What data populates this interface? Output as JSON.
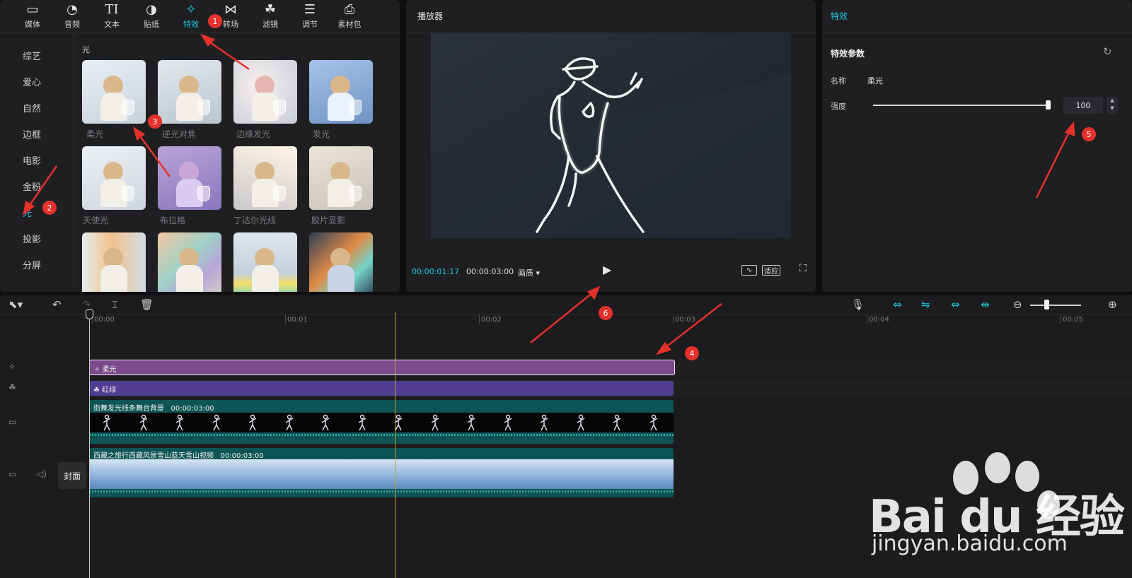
{
  "library": {
    "tabs": [
      {
        "label": "媒体",
        "icon": "media-icon"
      },
      {
        "label": "音频",
        "icon": "audio-icon"
      },
      {
        "label": "文本",
        "icon": "text-icon"
      },
      {
        "label": "贴纸",
        "icon": "sticker-icon"
      },
      {
        "label": "特效",
        "icon": "effects-icon",
        "active": true
      },
      {
        "label": "转场",
        "icon": "transition-icon"
      },
      {
        "label": "滤镜",
        "icon": "filter-icon"
      },
      {
        "label": "调节",
        "icon": "adjust-icon"
      },
      {
        "label": "素材包",
        "icon": "package-icon"
      }
    ],
    "categories": [
      "综艺",
      "爱心",
      "自然",
      "边框",
      "电影",
      "金粉",
      "光",
      "投影",
      "分屏"
    ],
    "active_category": "光",
    "section_title": "光",
    "effects": [
      "柔光",
      "逆光对焦",
      "边缘发光",
      "发光",
      "天使光",
      "布拉格",
      "丁达尔光线",
      "胶片显影",
      "",
      "",
      "",
      ""
    ]
  },
  "player": {
    "title": "播放器",
    "current_time": "00:00:01:17",
    "total_time": "00:00:03:00",
    "quality": "画质",
    "fit_label": "适应"
  },
  "properties": {
    "title": "特效",
    "section": "特效参数",
    "name_label": "名称",
    "name_value": "柔光",
    "strength_label": "强度",
    "strength_value": "100",
    "strength_fraction": 1.0
  },
  "timeline": {
    "ruler": [
      "00:00",
      "00:01",
      "00:02",
      "00:03",
      "00:04",
      "00:05"
    ],
    "effect_clip": "柔光",
    "filter_clip": "红绿",
    "video_clip_1": {
      "name": "街舞发光线条舞台背景",
      "duration": "00:00:03:00"
    },
    "video_clip_2": {
      "name": "西藏之旅行西藏风景雪山蓝天雪山视频",
      "duration": "00:00:03:00"
    },
    "cover_label": "封面"
  },
  "annotations": [
    "1",
    "2",
    "3",
    "4",
    "5",
    "6"
  ],
  "watermark": {
    "brand": "Bai du 经验",
    "url": "jingyan.baidu.com"
  },
  "colors": {
    "accent": "#1ec9e0",
    "effect_clip": "#7a4a8c",
    "filter_clip": "#4f3e93",
    "video_clip": "#0d5455",
    "badge": "#e5312b"
  }
}
